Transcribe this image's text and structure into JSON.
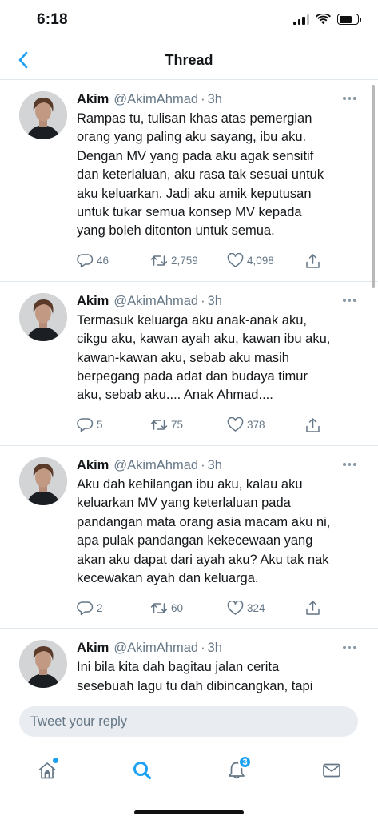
{
  "status_bar": {
    "time": "6:18"
  },
  "nav": {
    "title": "Thread"
  },
  "tweets": [
    {
      "name": "Akim",
      "handle": "@AkimAhmad",
      "separator": "·",
      "time": "3h",
      "text": "Rampas tu, tulisan khas atas pemergian\norang yang paling aku sayang, ibu aku.\nDengan MV yang pada aku agak sensitif\ndan keterlaluan, aku rasa tak sesuai untuk\naku keluarkan. Jadi aku amik keputusan\nuntuk tukar semua konsep MV kepada\nyang boleh ditonton untuk semua.",
      "replies": "46",
      "retweets": "2,759",
      "likes": "4,098"
    },
    {
      "name": "Akim",
      "handle": "@AkimAhmad",
      "separator": "·",
      "time": "3h",
      "text": "Termasuk keluarga aku anak-anak aku,\ncikgu aku, kawan ayah aku, kawan ibu aku,\nkawan-kawan aku, sebab aku masih\nberpegang pada adat dan budaya timur\naku, sebab aku.... Anak Ahmad....",
      "replies": "5",
      "retweets": "75",
      "likes": "378"
    },
    {
      "name": "Akim",
      "handle": "@AkimAhmad",
      "separator": "·",
      "time": "3h",
      "text": "Aku dah kehilangan ibu aku, kalau aku\nkeluarkan MV yang keterlaluan pada\npandangan mata orang asia macam aku ni,\napa pulak pandangan kekecewaan yang\nakan aku dapat dari ayah aku? Aku tak nak\nkecewakan ayah dan keluarga.",
      "replies": "2",
      "retweets": "60",
      "likes": "324"
    },
    {
      "name": "Akim",
      "handle": "@AkimAhmad",
      "separator": "·",
      "time": "3h",
      "text": "Ini bila kita dah bagitau jalan cerita\nsesebuah lagu tu dah dibincangkan, tapi\ntetap nak buat sesuatu atas sebab \"art\"\nsebab nak kepuasan nafsu sendiri dalam"
    }
  ],
  "reply": {
    "placeholder": "Tweet your reply"
  },
  "tabs": {
    "notifications_badge": "3"
  },
  "colors": {
    "accent": "#1da1f2",
    "text": "#14171a",
    "muted": "#657786",
    "divider": "#e1e8ed"
  },
  "icons": {
    "back": "chevron-left-icon",
    "more": "more-horizontal-icon",
    "reply": "reply-icon",
    "retweet": "retweet-icon",
    "like": "heart-icon",
    "share": "share-icon",
    "home": "home-icon",
    "search": "search-icon",
    "notifications": "bell-icon",
    "messages": "mail-icon"
  }
}
